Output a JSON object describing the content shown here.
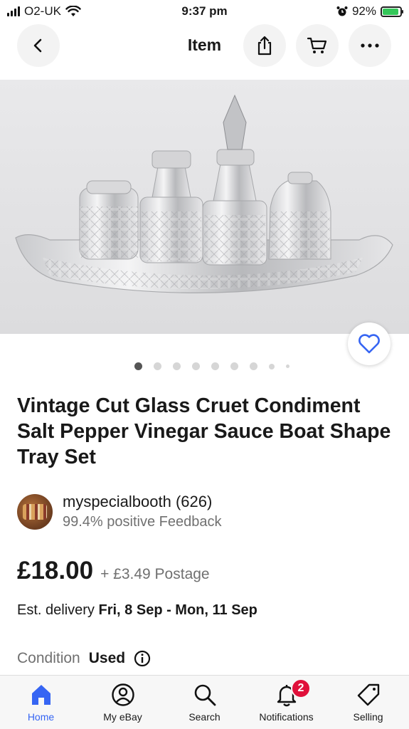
{
  "status_bar": {
    "carrier": "O2-UK",
    "time": "9:37 pm",
    "battery": "92%",
    "battery_level": 0.92
  },
  "nav": {
    "title": "Item"
  },
  "gallery": {
    "image_count": 9,
    "active_index": 0
  },
  "item": {
    "title": "Vintage Cut Glass Cruet Condiment Salt Pepper Vinegar Sauce Boat Shape Tray Set",
    "price": "£18.00",
    "postage": "+ £3.49 Postage",
    "delivery_label": "Est. delivery",
    "delivery_dates": "Fri, 8 Sep - Mon, 11 Sep",
    "condition_label": "Condition",
    "condition_value": "Used"
  },
  "seller": {
    "name": "myspecialbooth (626)",
    "feedback": "99.4% positive Feedback"
  },
  "tabbar": {
    "tabs": [
      {
        "label": "Home",
        "icon": "home-icon",
        "active": true
      },
      {
        "label": "My eBay",
        "icon": "user-circle-icon"
      },
      {
        "label": "Search",
        "icon": "search-icon"
      },
      {
        "label": "Notifications",
        "icon": "bell-icon",
        "badge": "2"
      },
      {
        "label": "Selling",
        "icon": "tag-icon"
      }
    ]
  },
  "colors": {
    "accent": "#3665f3",
    "badge": "#e0103a",
    "battery": "#34c759"
  }
}
